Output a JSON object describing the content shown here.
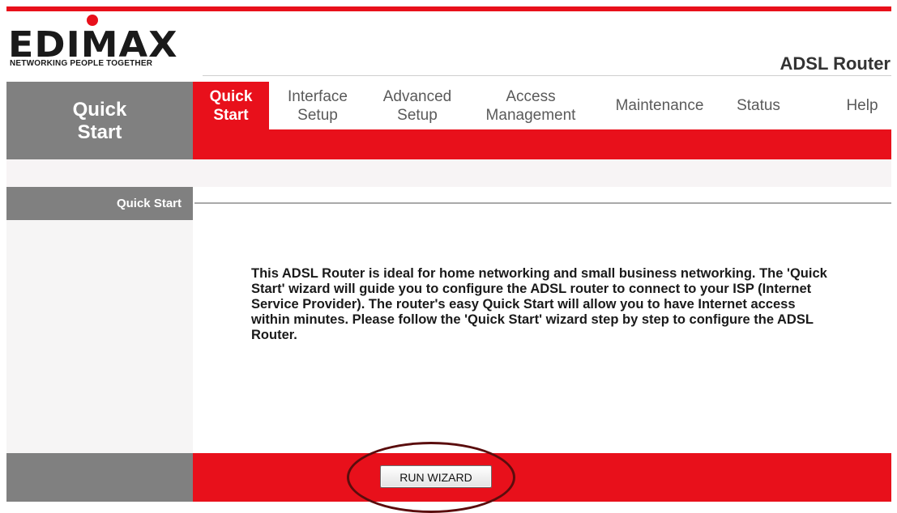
{
  "brand": {
    "logo_word": "EDIMAX",
    "tagline": "NETWORKING PEOPLE TOGETHER",
    "product": "ADSL Router",
    "accent_color": "#e8101b"
  },
  "nav": {
    "section_title": "Quick Start",
    "tabs": [
      {
        "line1": "Quick",
        "line2": "Start",
        "active": true
      },
      {
        "line1": "Interface",
        "line2": "Setup"
      },
      {
        "line1": "Advanced",
        "line2": "Setup"
      },
      {
        "line1": "Access",
        "line2": "Management"
      },
      {
        "line1": "Maintenance",
        "line2": ""
      },
      {
        "line1": "Status",
        "line2": ""
      },
      {
        "line1": "Help",
        "line2": ""
      }
    ]
  },
  "content": {
    "section_label": "Quick Start",
    "description": "This ADSL Router is ideal for home networking and small business networking. The 'Quick Start' wizard will guide you to configure the ADSL router to connect to your ISP (Internet Service Provider). The router's easy Quick Start will allow you to have Internet access within minutes. Please follow the 'Quick Start' wizard step by step to configure the ADSL Router."
  },
  "footer": {
    "run_wizard_label": "RUN WIZARD"
  }
}
